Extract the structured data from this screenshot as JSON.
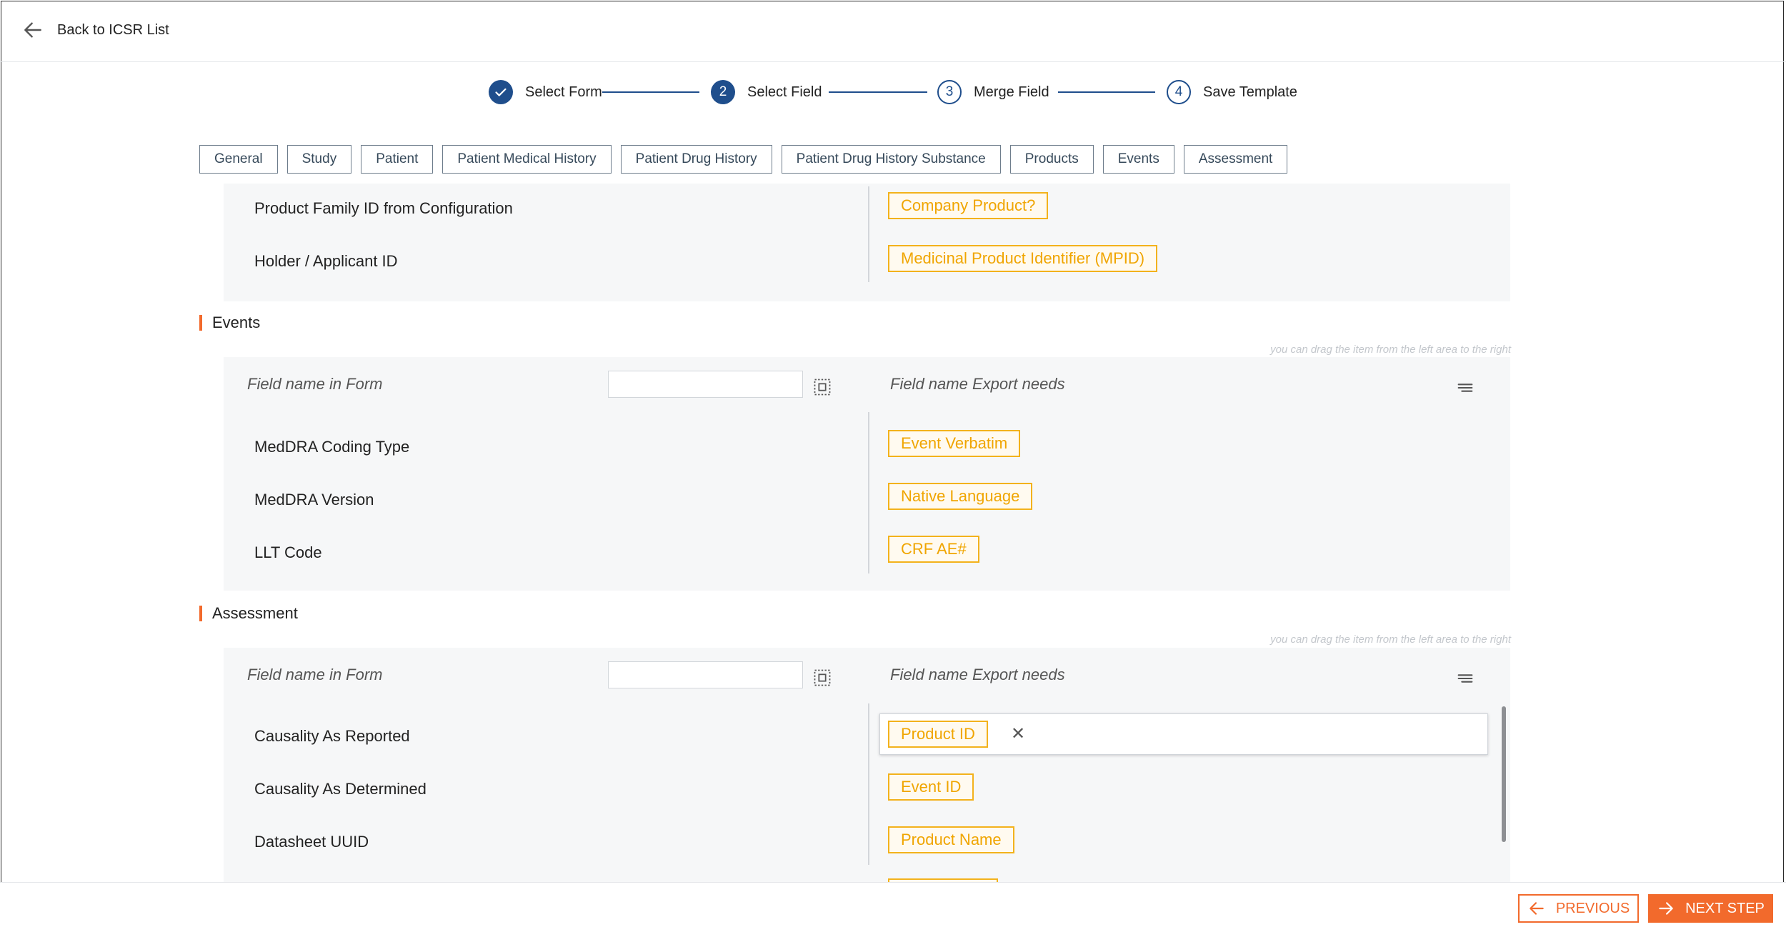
{
  "header": {
    "back_label": "Back to ICSR List"
  },
  "stepper": {
    "steps": [
      {
        "number": "1",
        "label": "Select Form",
        "state": "done"
      },
      {
        "number": "2",
        "label": "Select Field",
        "state": "active"
      },
      {
        "number": "3",
        "label": "Merge Field",
        "state": "todo"
      },
      {
        "number": "4",
        "label": "Save Template",
        "state": "todo"
      }
    ]
  },
  "tabs": [
    "General",
    "Study",
    "Patient",
    "Patient Medical History",
    "Patient Drug History",
    "Patient Drug History Substance",
    "Products",
    "Events",
    "Assessment"
  ],
  "products_section": {
    "rows": [
      {
        "field": "Product Family ID from Configuration",
        "tag": "Company Product?"
      },
      {
        "field": "Holder / Applicant ID",
        "tag": "Medicinal Product Identifier (MPID)"
      }
    ]
  },
  "events_section": {
    "title": "Events",
    "hint": "you can drag the item from the left area to the right",
    "form_col_header": "Field name in Form",
    "export_col_header": "Field name Export needs",
    "rows": [
      {
        "field": "MedDRA Coding Type",
        "tag": "Event Verbatim"
      },
      {
        "field": "MedDRA Version",
        "tag": "Native Language"
      },
      {
        "field": "LLT Code",
        "tag": "CRF AE#"
      }
    ]
  },
  "assessment_section": {
    "title": "Assessment",
    "hint": "you can drag the item from the left area to the right",
    "form_col_header": "Field name in Form",
    "export_col_header": "Field name Export needs",
    "rows": [
      {
        "field": "Causality As Reported",
        "tag": "Product ID"
      },
      {
        "field": "Causality As Determined",
        "tag": "Event ID"
      },
      {
        "field": "Datasheet UUID",
        "tag": "Product Name"
      }
    ]
  },
  "footer": {
    "previous_label": "PREVIOUS",
    "next_label": "NEXT STEP"
  },
  "colors": {
    "primary": "#1f4e8c",
    "accent": "#f26a2c",
    "tag": "#f3b21c"
  },
  "icons": {
    "back": "arrow-left-icon",
    "done_step": "check-icon",
    "select": "select-all-icon",
    "menu": "sort-lines-icon",
    "remove": "close-icon"
  }
}
